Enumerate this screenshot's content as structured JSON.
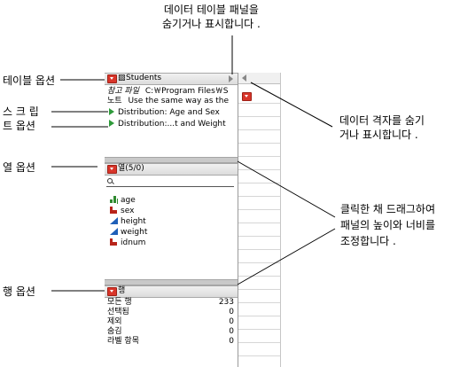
{
  "callouts": {
    "toggle_table_panel": "데이터 테이블 패널을\n숨기거나 표시합니다 .",
    "table_options": "테이블 옵션",
    "script_options": "스 크 립\n트 옵션",
    "toggle_grid": "데이터 격자를 숨기\n거나 표시합니다 .",
    "column_options": "열 옵션",
    "resize_panel": "클릭한 채 드래그하여\n패널의 높이와 너비를\n조정합니다 .",
    "row_options": "행 옵션"
  },
  "table_panel": {
    "title": "Students",
    "notes_label": "참고 파일",
    "notes_path": "C:￦Program Files￦S",
    "notes_text_label": "노트",
    "notes_text": "Use the same way as the",
    "scripts": [
      "Distribution: Age and Sex",
      "Distribution:...t and Weight"
    ]
  },
  "columns_panel": {
    "header": "열(5/0)",
    "search_placeholder": "",
    "columns": [
      {
        "name": "age",
        "type": "ordinal-icon"
      },
      {
        "name": "sex",
        "type": "nominal-icon"
      },
      {
        "name": "height",
        "type": "continuous-icon"
      },
      {
        "name": "weight",
        "type": "continuous-icon"
      },
      {
        "name": "idnum",
        "type": "nominal-icon"
      }
    ]
  },
  "rows_panel": {
    "header": "행",
    "rows": [
      {
        "label": "모든 행",
        "value": "233"
      },
      {
        "label": "선택됨",
        "value": "0"
      },
      {
        "label": "제외",
        "value": "0"
      },
      {
        "label": "숨김",
        "value": "0"
      },
      {
        "label": "라벨 항목",
        "value": "0"
      }
    ]
  },
  "colors": {
    "menu_button": "#d8352a",
    "script_arrow": "#2e9a3a",
    "continuous": "#1f5fb8",
    "nominal": "#b8241a",
    "ordinal": "#2f8a2f"
  }
}
